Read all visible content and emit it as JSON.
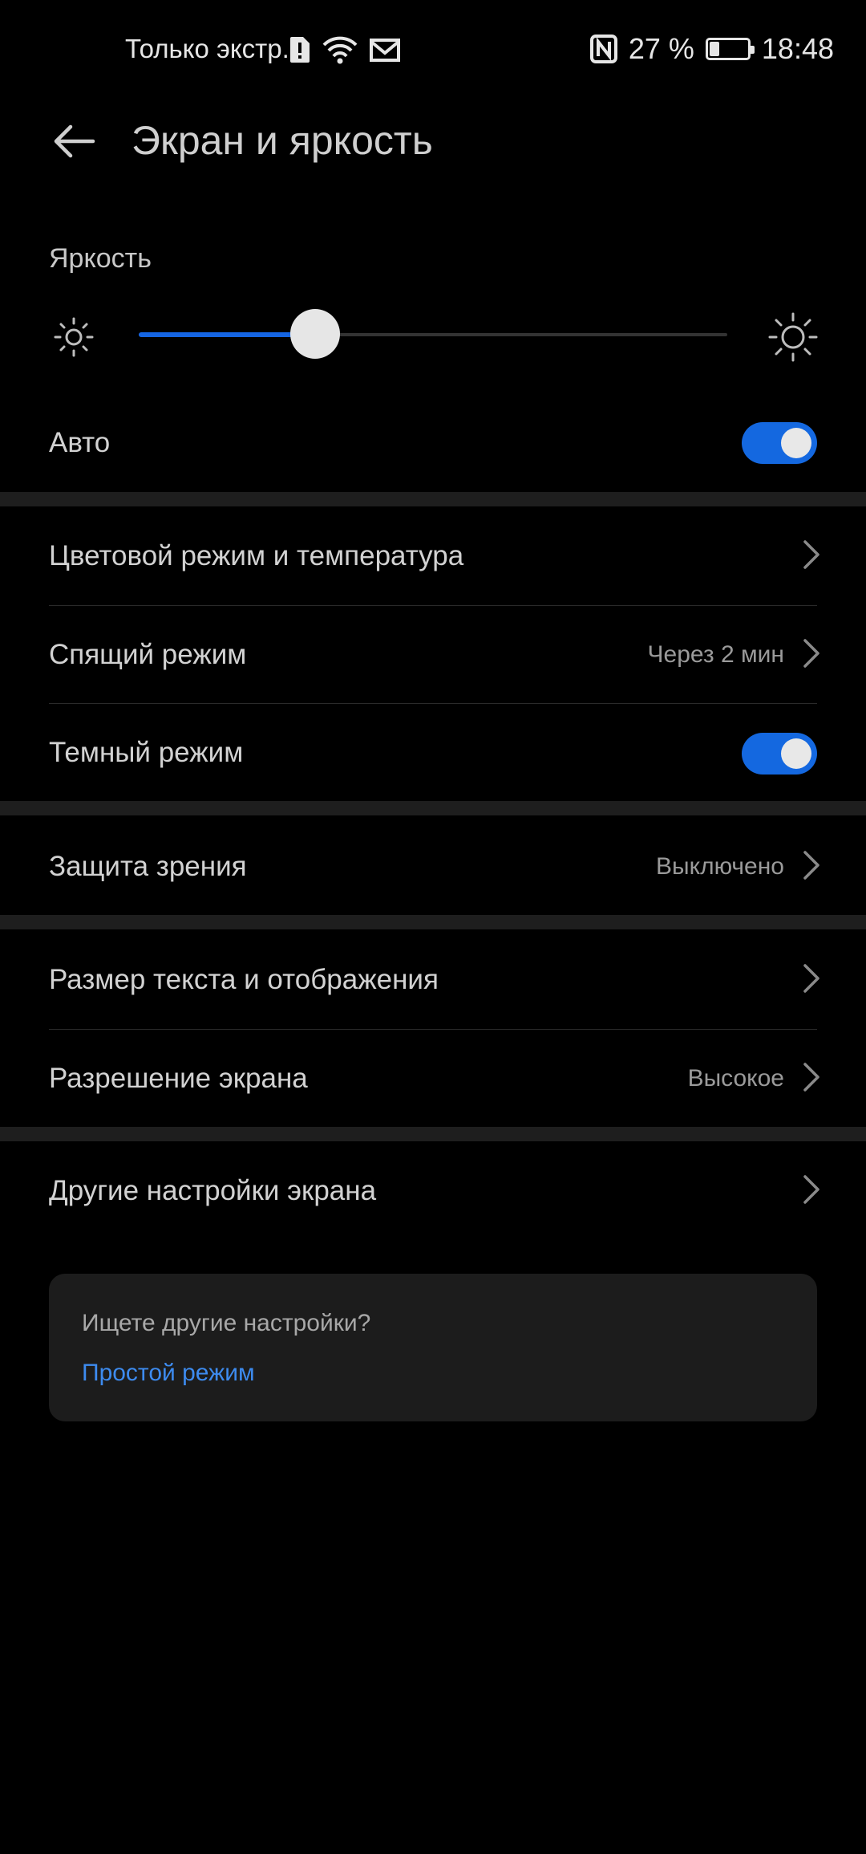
{
  "status_bar": {
    "carrier": "Только экстр....",
    "battery_percent": "27 %",
    "battery_level": 0.27,
    "time": "18:48"
  },
  "header": {
    "title": "Экран и яркость"
  },
  "brightness": {
    "label": "Яркость",
    "level": 0.3
  },
  "auto": {
    "label": "Авто",
    "on": true
  },
  "section1": {
    "color_mode": {
      "label": "Цветовой режим и температура"
    },
    "sleep": {
      "label": "Спящий режим",
      "value": "Через 2 мин"
    },
    "dark_mode": {
      "label": "Темный режим",
      "on": true
    }
  },
  "section2": {
    "eye_comfort": {
      "label": "Защита зрения",
      "value": "Выключено"
    }
  },
  "section3": {
    "text_size": {
      "label": "Размер текста и отображения"
    },
    "resolution": {
      "label": "Разрешение экрана",
      "value": "Высокое"
    }
  },
  "section4": {
    "more_settings": {
      "label": "Другие настройки экрана"
    }
  },
  "suggestion_card": {
    "question": "Ищете другие настройки?",
    "link": "Простой режим"
  },
  "colors": {
    "accent": "#1468e0",
    "link": "#3d8bef",
    "background": "#000000"
  }
}
